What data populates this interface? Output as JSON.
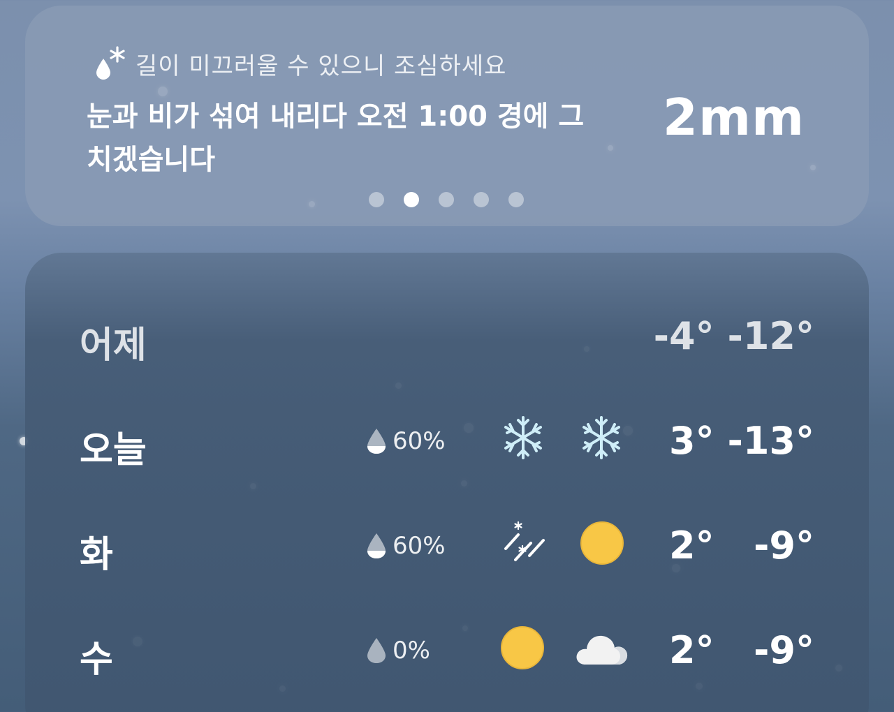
{
  "alert": {
    "icon": "sleet-icon",
    "warning": "길이 미끄러울 수 있으니 조심하세요",
    "headline": "눈과 비가 섞여 내리다 오전 1:00 경에 그치겠습니다",
    "amount": "2mm",
    "pages": 5,
    "active_page": 2
  },
  "forecast": [
    {
      "day": "어제",
      "precip": "",
      "icon_day": "",
      "icon_night": "",
      "high": "-4°",
      "low": "-12°"
    },
    {
      "day": "오늘",
      "precip": "60%",
      "icon_day": "snowflake-icon",
      "icon_night": "snowflake-icon",
      "high": "3°",
      "low": "-13°"
    },
    {
      "day": "화",
      "precip": "60%",
      "icon_day": "sleet-icon",
      "icon_night": "sun-icon",
      "high": "2°",
      "low": "-9°"
    },
    {
      "day": "수",
      "precip": "0%",
      "icon_day": "sun-icon",
      "icon_night": "cloud-icon",
      "high": "2°",
      "low": "-9°"
    }
  ],
  "colors": {
    "sun": "#f8c746",
    "snowflake": "#cfeef8",
    "text": "#ffffff"
  }
}
